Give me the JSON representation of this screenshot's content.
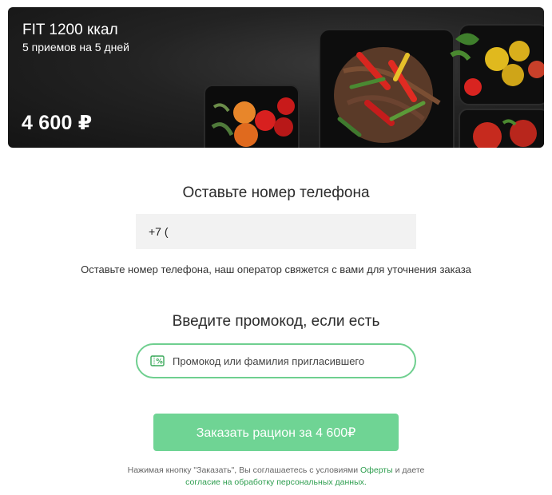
{
  "plan": {
    "title": "FIT 1200 ккал",
    "subtitle": "5 приемов на 5 дней",
    "price": "4 600 ₽"
  },
  "phone_section": {
    "heading": "Оставьте номер телефона",
    "input_value": "+7 (",
    "hint": "Оставьте номер телефона, наш оператор свяжется с вами для уточнения заказа"
  },
  "promo_section": {
    "heading": "Введите промокод, если есть",
    "placeholder": "Промокод или фамилия пригласившего",
    "icon": "coupon-percent-icon"
  },
  "order_button": {
    "label": "Заказать рацион за 4 600₽"
  },
  "legal": {
    "prefix": "Нажимая кнопку \"Заказать\", Вы соглашаетесь с условиями ",
    "offer_link": "Оферты",
    "middle": " и даете",
    "consent_link": "согласие на обработку персональных данных."
  },
  "colors": {
    "accent_green": "#6fd494",
    "promo_border": "#6fcf8f",
    "link_green": "#2e9e4f"
  }
}
